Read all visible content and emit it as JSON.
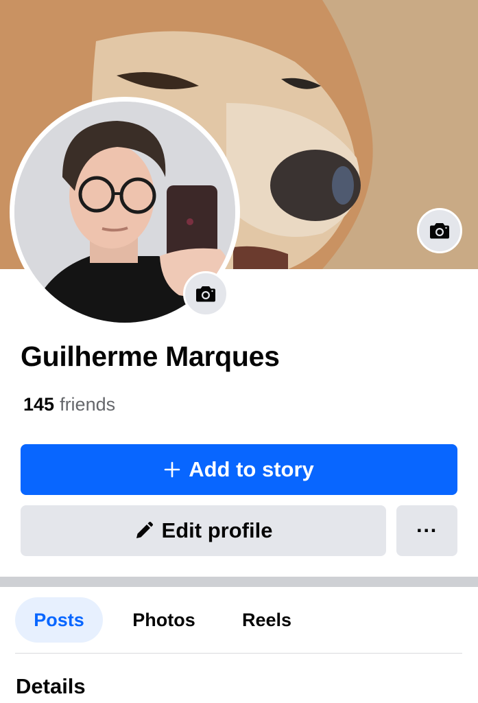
{
  "profile": {
    "name": "Guilherme Marques",
    "friends_count": "145",
    "friends_label": "friends"
  },
  "actions": {
    "add_story_label": "Add to story",
    "edit_profile_label": "Edit profile",
    "more_label": "···"
  },
  "tabs": [
    {
      "label": "Posts",
      "active": true
    },
    {
      "label": "Photos",
      "active": false
    },
    {
      "label": "Reels",
      "active": false
    }
  ],
  "section": {
    "details_heading": "Details"
  },
  "icons": {
    "cover_camera": "camera-icon",
    "avatar_camera": "camera-icon",
    "story_plus": "plus-icon",
    "edit_pencil": "pencil-icon",
    "more": "more-horizontal-icon"
  },
  "colors": {
    "primary": "#0866ff",
    "secondary_button": "#e4e6eb",
    "active_tab_bg": "#e7f0fe",
    "text": "#050505",
    "muted_text": "#65676b"
  }
}
